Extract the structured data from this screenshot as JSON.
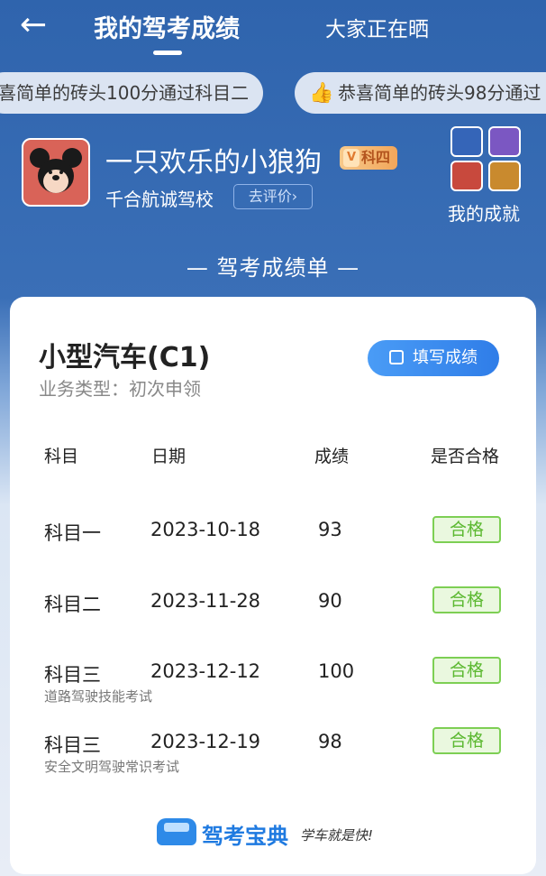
{
  "nav": {
    "back_icon": "arrow-left-icon",
    "tab_active": "我的驾考成绩",
    "tab_other": "大家正在晒"
  },
  "ticker": {
    "items": [
      "喜简单的砖头100分通过科目二",
      "恭喜简单的砖头98分通过"
    ],
    "thumb_icon": "thumbs-up-icon"
  },
  "profile": {
    "nickname": "一只欢乐的小狼狗",
    "badge_v": "V",
    "badge_level": "科四",
    "school": "千合航诚驾校",
    "review_label": "去评价›"
  },
  "achievements": {
    "label": "我的成就",
    "medal_icons": [
      "medal-blue-icon",
      "medal-purple-icon",
      "medal-red-icon",
      "medal-gold-icon"
    ]
  },
  "sheet_title": "— 驾考成绩单 —",
  "card": {
    "car_type": "小型汽车(C1)",
    "business": "业务类型：初次申领",
    "fill_button": "填写成绩",
    "headers": [
      "科目",
      "日期",
      "成绩",
      "是否合格"
    ],
    "rows": [
      {
        "subject": "科目一",
        "date": "2023-10-18",
        "score": "93",
        "status": "合格",
        "note": ""
      },
      {
        "subject": "科目二",
        "date": "2023-11-28",
        "score": "90",
        "status": "合格",
        "note": ""
      },
      {
        "subject": "科目三",
        "date": "2023-12-12",
        "score": "100",
        "status": "合格",
        "note": "道路驾驶技能考试"
      },
      {
        "subject": "科目三",
        "date": "2023-12-19",
        "score": "98",
        "status": "合格",
        "note": "安全文明驾驶常识考试"
      }
    ]
  },
  "footer": {
    "brand": "驾考宝典",
    "slogan": "学车就是快!"
  }
}
